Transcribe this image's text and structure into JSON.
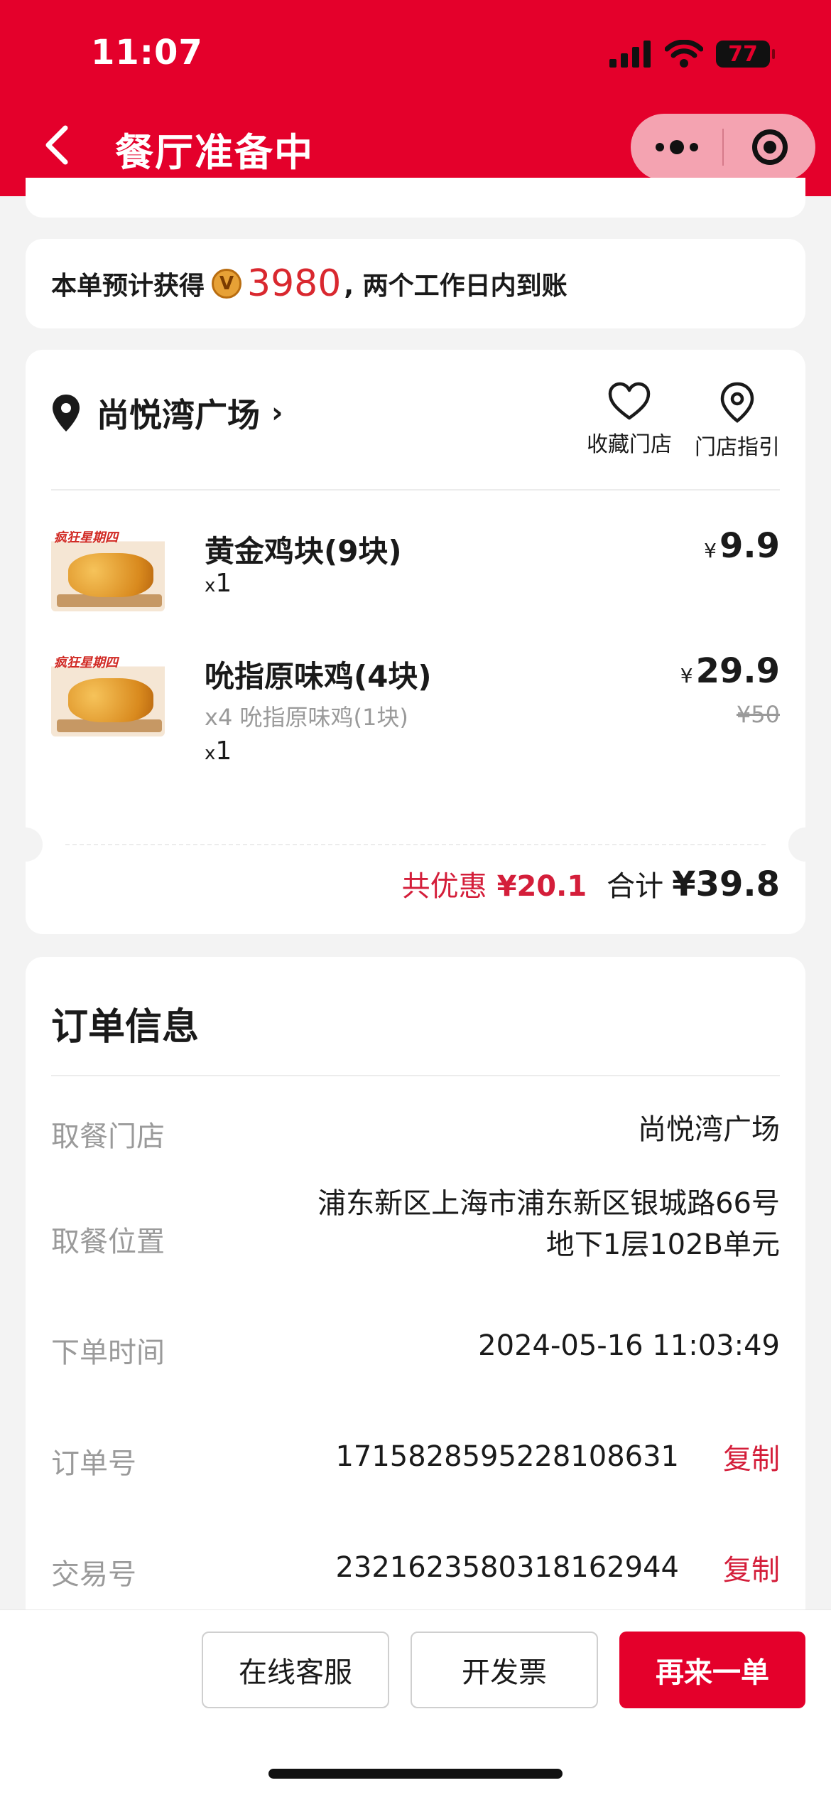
{
  "status_bar": {
    "time": "11:07",
    "battery": "77"
  },
  "header": {
    "title": "餐厅准备中"
  },
  "points": {
    "prefix": "本单预计获得",
    "badge": "V",
    "amount": "3980",
    "suffix": ", 两个工作日内到账"
  },
  "store": {
    "name": "尚悦湾广场",
    "arrow": "›",
    "actions": [
      {
        "label": "收藏门店",
        "icon": "heart-icon"
      },
      {
        "label": "门店指引",
        "icon": "location-pin-icon"
      }
    ]
  },
  "items": [
    {
      "name": "黄金鸡块(9块)",
      "tag": "疯狂星期四",
      "qty_prefix": "x",
      "qty": "1",
      "currency": "¥",
      "price": "9.9"
    },
    {
      "name": "吮指原味鸡(4块)",
      "tag": "疯狂星期四",
      "sub": "x4 吮指原味鸡(1块)",
      "qty_prefix": "x",
      "qty": "1",
      "currency": "¥",
      "price": "29.9",
      "original_price": "¥50"
    }
  ],
  "totals": {
    "discount_label": "共优惠",
    "discount": "¥20.1",
    "total_label": "合计",
    "total": "¥39.8"
  },
  "order_info": {
    "title": "订单信息",
    "store_label": "取餐门店",
    "store_value": "尚悦湾广场",
    "location_label": "取餐位置",
    "location_line1": "浦东新区上海市浦东新区银城路66号",
    "location_line2": "地下1层102B单元",
    "time_label": "下单时间",
    "time_value": "2024-05-16 11:03:49",
    "order_no_label": "订单号",
    "order_no": "1715828595228108631",
    "trade_no_label": "交易号",
    "trade_no": "2321623580318162944",
    "copy_label": "复制"
  },
  "bottom": {
    "service": "在线客服",
    "invoice": "开发票",
    "reorder": "再来一单"
  },
  "colors": {
    "brand": "#e4002b",
    "discount": "#d41e3a",
    "points": "#d9282f"
  }
}
